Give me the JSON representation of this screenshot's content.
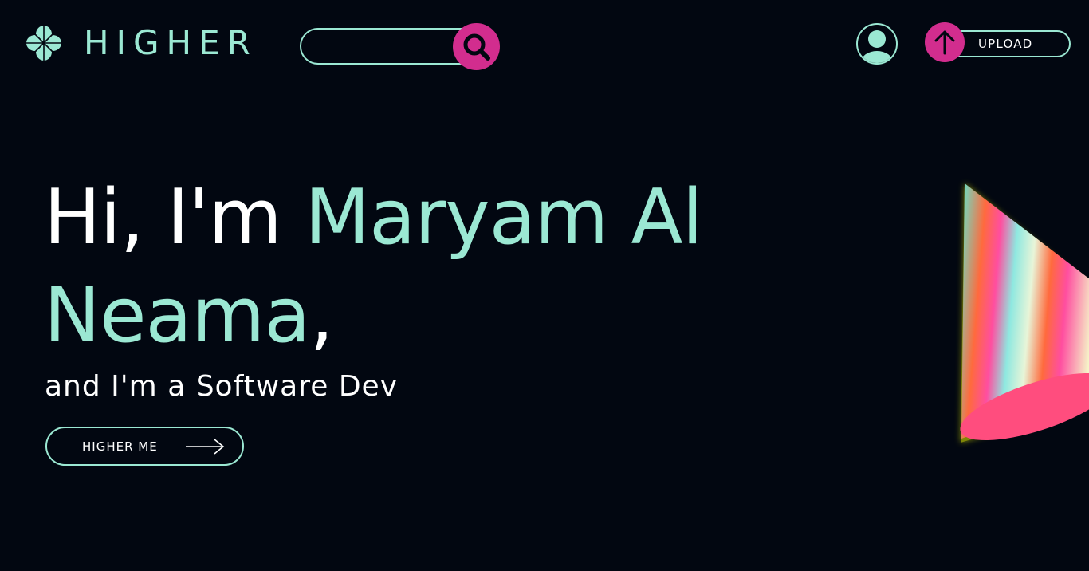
{
  "header": {
    "brand": "HIGHER",
    "search": {
      "placeholder": "",
      "value": ""
    },
    "upload_label": "UPLOAD"
  },
  "hero": {
    "greeting": "Hi, I'm ",
    "name_part1": "Maryam Al",
    "name_part2": "Neama",
    "name_comma": ",",
    "subtitle": "and I'm a Software Dev",
    "cta_label": "HIGHER ME"
  },
  "colors": {
    "background": "#020711",
    "accent": "#9be8d3",
    "brand_pink": "#d22d8e",
    "text": "#ffffff"
  },
  "icons": {
    "logo": "flower-logo-icon",
    "search": "search-icon",
    "avatar": "user-icon",
    "upload": "arrow-up-icon",
    "cta": "arrow-right-icon",
    "decoration": "gradient-cone-graphic"
  }
}
